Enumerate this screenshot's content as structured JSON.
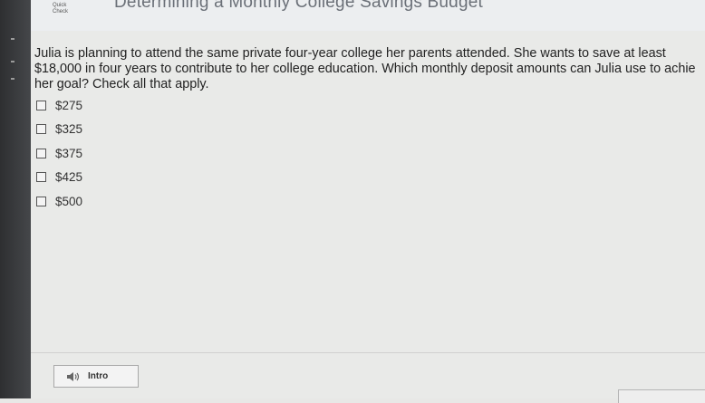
{
  "header": {
    "quick_check": "Quick\nCheck",
    "lesson_title": "Determining a Monthly College Savings Budget"
  },
  "question": {
    "text": "Julia is planning to attend the same private four-year college her parents attended. She wants to save at least $18,000 in four years to contribute to her college education. Which monthly deposit amounts can Julia use to achie her goal? Check all that apply."
  },
  "choices": [
    {
      "label": "$275"
    },
    {
      "label": "$325"
    },
    {
      "label": "$375"
    },
    {
      "label": "$425"
    },
    {
      "label": "$500"
    }
  ],
  "footer": {
    "intro_label": "Intro",
    "intro_icon": "speaker-icon"
  }
}
